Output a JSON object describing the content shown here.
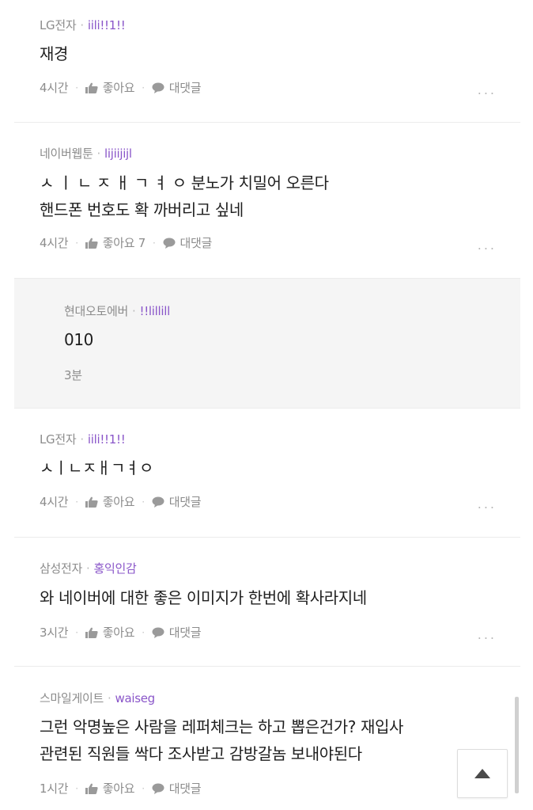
{
  "comments": [
    {
      "company": "LG전자",
      "nickname": "iili!!1!!",
      "body_lines": [
        "재경"
      ],
      "time": "4시간",
      "like_label": "좋아요",
      "reply_label": "대댓글",
      "more": "..."
    },
    {
      "company": "네이버웹툰",
      "nickname": "lijiijijl",
      "body_lines": [
        "ㅅ ㅣ ㄴ ㅈ ㅐ ㄱ ㅕ ㅇ 분노가 치밀어 오른다",
        "핸드폰 번호도 확 까버리고 싶네"
      ],
      "time": "4시간",
      "like_label": "좋아요 7",
      "reply_label": "대댓글",
      "more": "..."
    },
    {
      "company": "현대오토에버",
      "nickname": "!!lillill",
      "body_lines": [
        "010"
      ],
      "time": "3분"
    },
    {
      "company": "LG전자",
      "nickname": "iili!!1!!",
      "body_lines": [
        "ㅅㅣㄴㅈㅐㄱㅕㅇ"
      ],
      "time": "4시간",
      "like_label": "좋아요",
      "reply_label": "대댓글",
      "more": "..."
    },
    {
      "company": "삼성전자",
      "nickname": "홍익인감",
      "body_lines": [
        "와 네이버에 대한 좋은 이미지가 한번에 확사라지네"
      ],
      "time": "3시간",
      "like_label": "좋아요",
      "reply_label": "대댓글",
      "more": "..."
    },
    {
      "company": "스마일게이트",
      "nickname": "waiseg",
      "body_lines": [
        "그런 악명높은 사람을 레퍼체크는 하고 뽑은건가? 재입사",
        "관련된 직원들 싹다 조사받고 감방갈놈 보내야된다"
      ],
      "time": "1시간",
      "like_label": "좋아요",
      "reply_label": "대댓글"
    }
  ],
  "separator": "·",
  "colors": {
    "nickname": "#8a56c9",
    "meta": "#8c8c8c",
    "reply_bg": "#f5f5f5"
  },
  "icons": {
    "like": "thumbs-up-icon",
    "reply": "speech-bubble-icon",
    "top": "caret-up-icon"
  }
}
